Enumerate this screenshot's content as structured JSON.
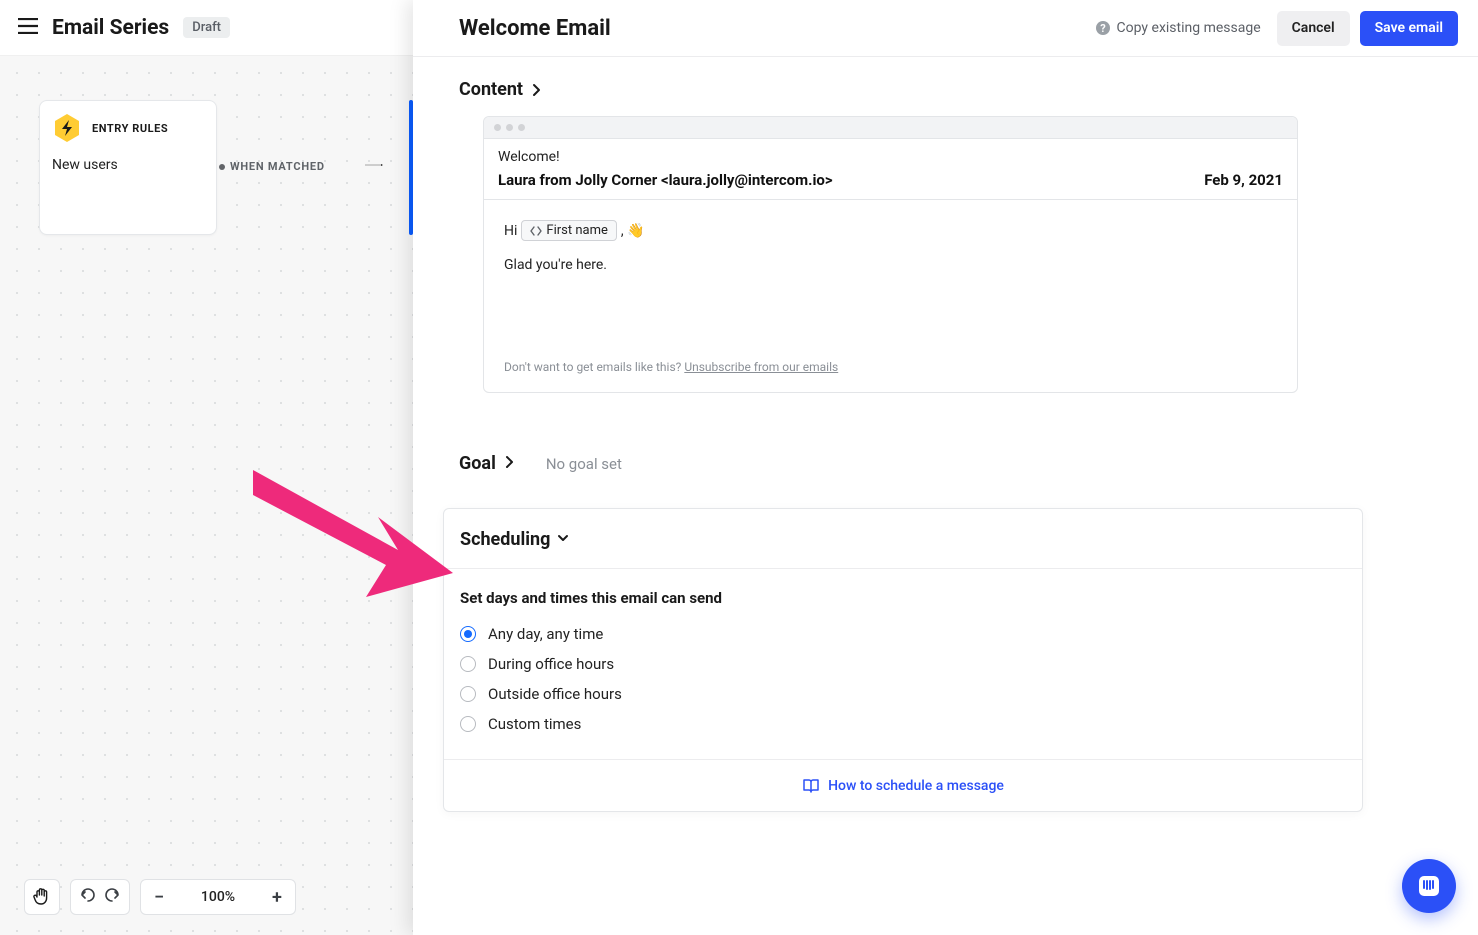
{
  "topbar": {
    "title": "Email Series",
    "status_badge": "Draft"
  },
  "canvas": {
    "node": {
      "tag": "ENTRY RULES",
      "description": "New users"
    },
    "edge_label": "WHEN MATCHED",
    "toolbar": {
      "zoom_level": "100%"
    }
  },
  "drawer": {
    "title": "Welcome Email",
    "actions": {
      "copy_link": "Copy existing message",
      "cancel": "Cancel",
      "save": "Save email"
    },
    "content_section_label": "Content",
    "email_preview": {
      "subject": "Welcome!",
      "from": "Laura from Jolly Corner <laura.jolly@intercom.io>",
      "date": "Feb 9, 2021",
      "hi_prefix": "Hi ",
      "attribute_chip": "First name",
      "hi_suffix": ", 👋",
      "body_line": "Glad you're here.",
      "unsubscribe_prefix": "Don't want to get emails like this? ",
      "unsubscribe_link": "Unsubscribe from our emails"
    },
    "goal": {
      "label": "Goal",
      "status": "No goal set"
    },
    "scheduling": {
      "label": "Scheduling",
      "subheading": "Set days and times this email can send",
      "options": [
        "Any day, any time",
        "During office hours",
        "Outside office hours",
        "Custom times"
      ],
      "selected_index": 0,
      "help_link": "How to schedule a message"
    }
  }
}
